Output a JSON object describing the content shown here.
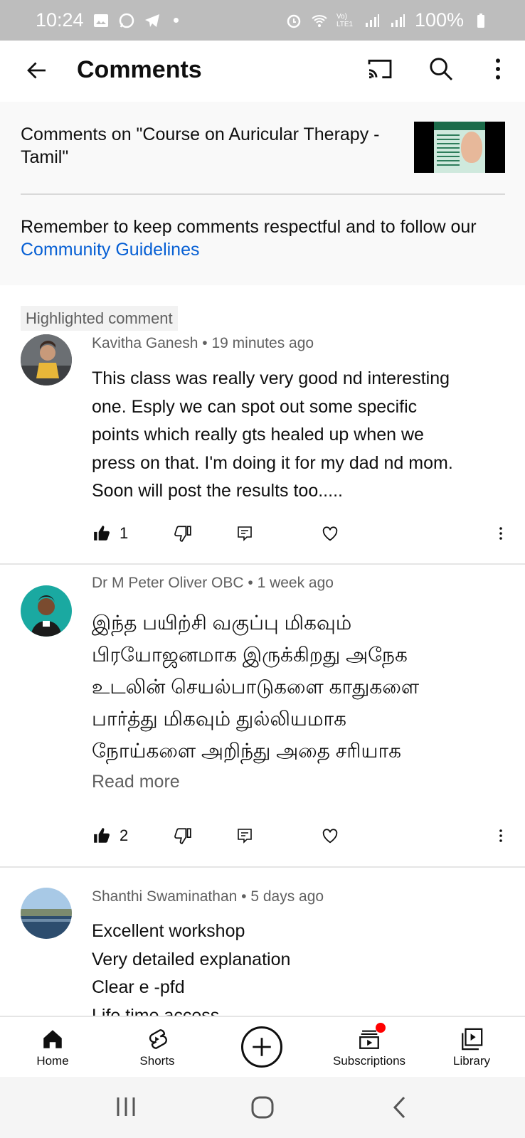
{
  "status_bar": {
    "time": "10:24",
    "battery": "100%",
    "lte_label": "Vo) LTE1",
    "left_icons": [
      "gallery-icon",
      "whatsapp-icon",
      "telegram-icon",
      "dot-icon"
    ],
    "right_icons": [
      "alarm-icon",
      "wifi-icon",
      "lte-icon",
      "signal-icon",
      "signal-icon",
      "battery-icon"
    ]
  },
  "app_bar": {
    "title": "Comments",
    "icons": [
      "back-arrow-icon",
      "cast-icon",
      "search-icon",
      "more-vert-icon"
    ]
  },
  "header": {
    "video_title": "Comments on \"Course on Auricular Therapy  -  Tamil\"",
    "remember_text": "Remember to keep comments respectful and to follow our ",
    "guidelines_link": "Community Guidelines"
  },
  "comments": [
    {
      "chip": "Highlighted comment",
      "author": "Kavitha Ganesh",
      "time": "19 minutes ago",
      "lines": [
        "This class was really very good nd interesting",
        "one.  Esply we can spot out some specific",
        "points which really gts healed up when we",
        "press on that. I'm doing it for my dad nd mom.",
        "Soon will post the results too....."
      ],
      "likes": "1"
    },
    {
      "author": "Dr M Peter Oliver OBC",
      "time": "1 week ago",
      "lines": [
        "இந்த பயிற்சி வகுப்பு மிகவும்",
        "பிரயோஜனமாக இருக்கிறது அநேக",
        "உடலின் செயல்பாடுகளை காதுகளை",
        "பார்த்து மிகவும் துல்லியமாக",
        "நோய்களை அறிந்து அதை சரியாக"
      ],
      "read_more": "Read more",
      "likes": "2"
    },
    {
      "author": "Shanthi Swaminathan",
      "time": "5 days ago",
      "lines": [
        "Excellent workshop",
        "Very detailed explanation",
        "Clear e -pfd",
        "Life time access"
      ]
    }
  ],
  "bottom_nav": {
    "items": [
      {
        "label": "Home",
        "icon": "home-icon"
      },
      {
        "label": "Shorts",
        "icon": "shorts-icon"
      },
      {
        "label": "",
        "icon": "create-plus-icon"
      },
      {
        "label": "Subscriptions",
        "icon": "subscriptions-icon"
      },
      {
        "label": "Library",
        "icon": "library-icon"
      }
    ]
  },
  "system_nav": {
    "icons": [
      "recents-icon",
      "home-circle-icon",
      "back-chevron-icon"
    ]
  },
  "colors": {
    "link": "#065fd4",
    "meta": "#606060",
    "badge": "#ff0000"
  }
}
